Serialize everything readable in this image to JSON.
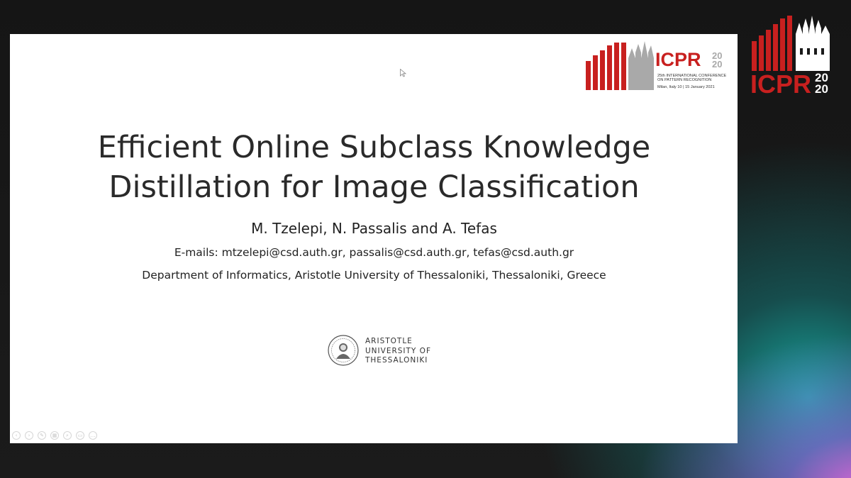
{
  "slide": {
    "title_lines": [
      "Efficient Online Subclass Knowledge",
      "Distillation for Image Classification"
    ],
    "authors": "M. Tzelepi, N. Passalis and A. Tefas",
    "emails": "E-mails: mtzelepi@csd.auth.gr, passalis@csd.auth.gr, tefas@csd.auth.gr",
    "department": "Department of Informatics, Aristotle University of Thessaloniki, Thessaloniki, Greece"
  },
  "conference_logo": {
    "name": "ICPR",
    "year_top": "20",
    "year_bottom": "20",
    "caption_lines": [
      "25th INTERNATIONAL CONFERENCE",
      "ON PATTERN RECOGNITION"
    ],
    "dates": "Milan, Italy 10 | 15 January 2021",
    "color": "#c8201f"
  },
  "corner_logo": {
    "name": "ICPR",
    "year_top": "20",
    "year_bottom": "20",
    "color": "#c8201f"
  },
  "university_logo": {
    "lines": [
      "ARISTOTLE",
      "UNIVERSITY OF",
      "THESSALONIKI"
    ]
  },
  "toolbar": {
    "icons": [
      "previous-icon",
      "next-icon",
      "pen-icon",
      "slides-icon",
      "zoom-icon",
      "subtitles-icon",
      "more-icon"
    ]
  }
}
